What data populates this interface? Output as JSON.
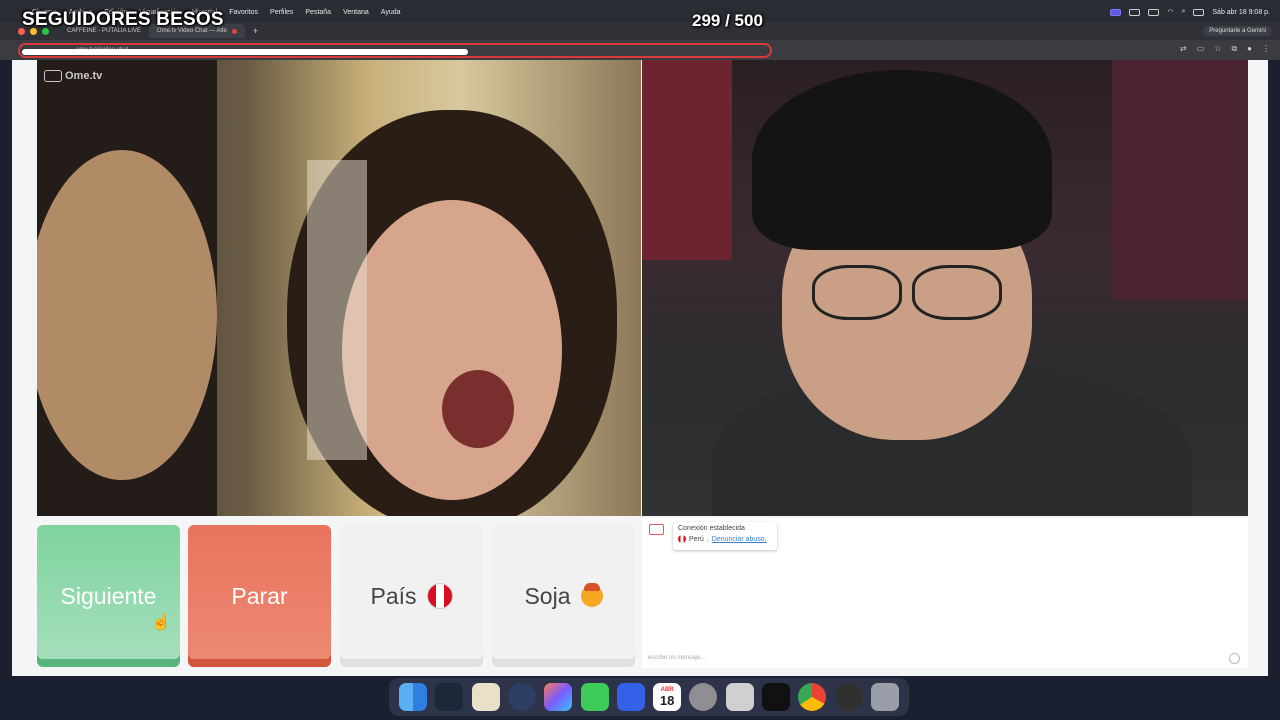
{
  "overlay": {
    "title": "SEGUIDORES BESOS",
    "counter": "299 / 500"
  },
  "menubar": {
    "items": [
      "Chrome",
      "Archivo",
      "Edición",
      "Visualización",
      "Historial",
      "Favoritos",
      "Perfiles",
      "Pestaña",
      "Ventana",
      "Ayuda"
    ],
    "clock": "Sáb abr 18  9:08 p."
  },
  "browser": {
    "tabs": [
      {
        "label": "CAFFEINE - PUTALIA LIVE",
        "active": false
      },
      {
        "label": "Ome.tv Video Chat — Alte",
        "active": true
      }
    ],
    "new_tab": "+",
    "gemini": "Preguntarle a Gemini",
    "url": "ome.tv/#/video-chat"
  },
  "app": {
    "logo": "Ome.tv",
    "buttons": {
      "next": "Siguiente",
      "stop": "Parar",
      "country": "País",
      "gender": "Soja"
    },
    "chat": {
      "status": "Conexión establecida",
      "country": "Perú",
      "report": "Denunciar abuso.",
      "placeholder": "escribe un mensaje..."
    }
  },
  "dock": {
    "apps": [
      "finder-icon",
      "steam-icon",
      "notes-icon",
      "quicktime-icon",
      "launchpad-icon",
      "messages-icon",
      "roblox-icon",
      "calendar-icon",
      "settings-icon",
      "screenshot-icon",
      "capcut-icon",
      "chrome-icon",
      "obs-icon",
      "trash-icon"
    ],
    "calendar_month": "ABR",
    "calendar_day": "18"
  },
  "colors": {
    "next_green": "#7fd39f",
    "stop_red": "#e9735d",
    "url_highlight": "#d63a3a"
  }
}
